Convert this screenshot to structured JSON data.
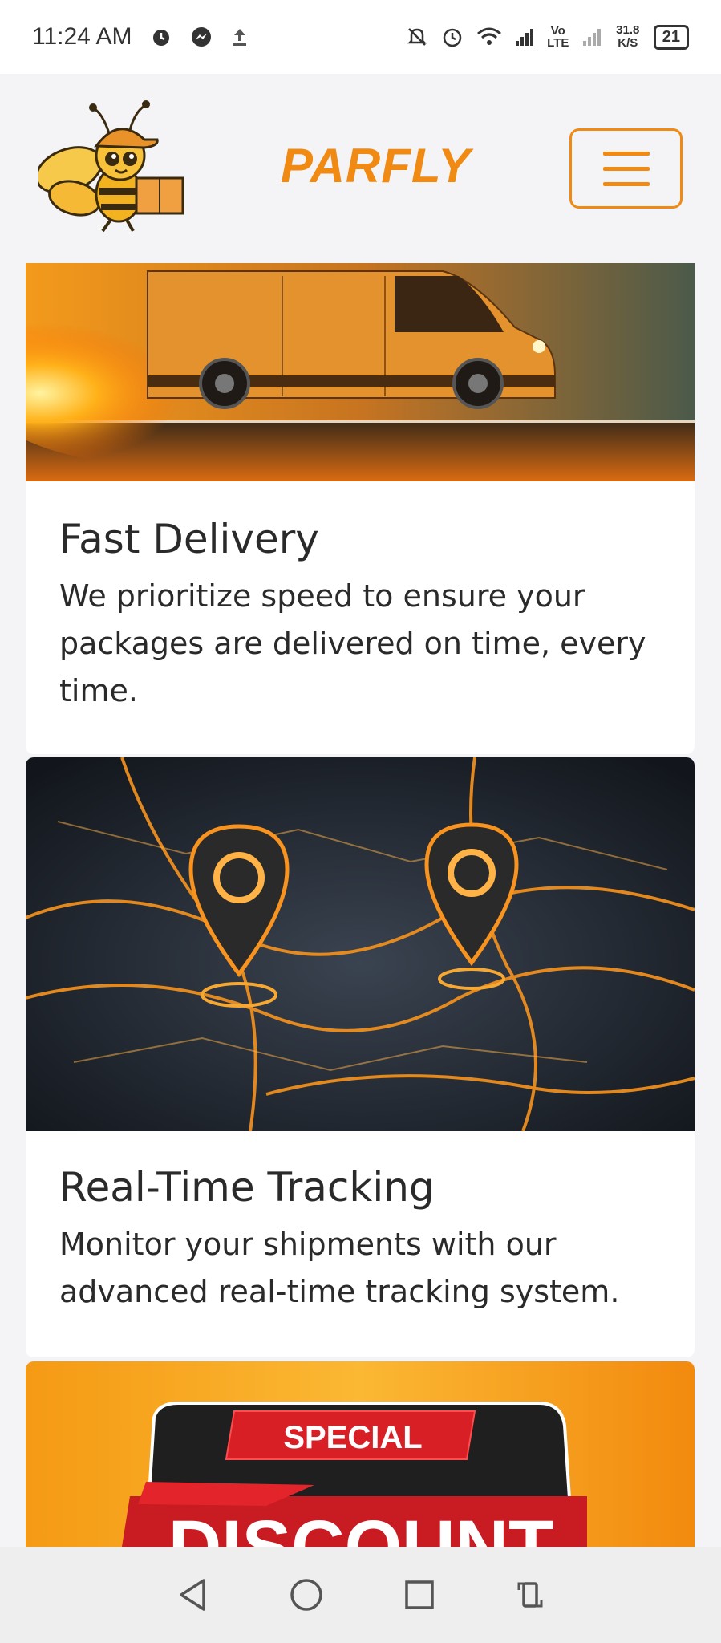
{
  "status_bar": {
    "time": "11:24 AM",
    "network": "Vo LTE",
    "speed": "31.8 K/S",
    "battery": "21"
  },
  "header": {
    "brand": "PARFLY",
    "logo_icon": "bee-courier-logo-icon",
    "menu_icon": "hamburger-menu-icon"
  },
  "cards": [
    {
      "title": "Fast Delivery",
      "text": "We prioritize speed to ensure your packages are delivered on time, every time.",
      "image_icon": "fiery-delivery-van-image"
    },
    {
      "title": "Real-Time Tracking",
      "text": "Monitor your shipments with our advanced real-time tracking system.",
      "image_icon": "map-pins-tracking-image"
    },
    {
      "banner_top": "SPECIAL",
      "banner_bottom": "DISCOUNT",
      "image_icon": "special-discount-banner-image"
    }
  ],
  "colors": {
    "brand_orange": "#f08a12",
    "page_bg": "#f4f4f6",
    "text": "#2a2a2a"
  }
}
